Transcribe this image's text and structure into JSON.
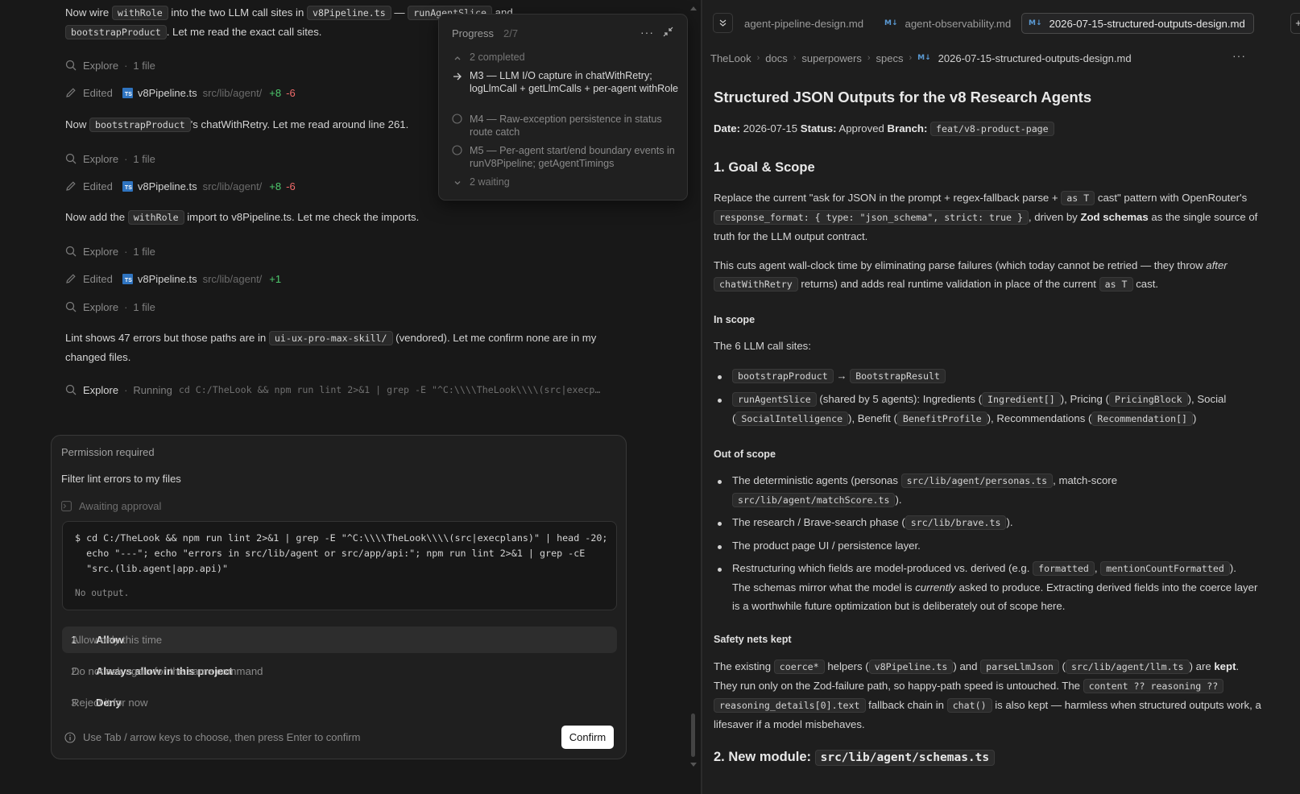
{
  "chat": {
    "msg1_a": "Now wire ",
    "msg1_code1": "withRole",
    "msg1_b": " into the two LLM call sites in ",
    "msg1_code2": "v8Pipeline.ts",
    "msg1_c": " — ",
    "msg1_code3": "runAgentSlice",
    "msg1_d": " and",
    "msg1_code4": "bootstrapProduct",
    "msg1_e": ". Let me read the exact call sites.",
    "explore_label": "Explore",
    "explore_count": "1 file",
    "edited_label": "Edited",
    "file_name": "v8Pipeline.ts",
    "file_path": "src/lib/agent/",
    "edit1_add": "+8",
    "edit1_del": "-6",
    "msg2_a": "Now ",
    "msg2_code": "bootstrapProduct",
    "msg2_b": "'s chatWithRetry. Let me read around line 261.",
    "edit2_add": "+8",
    "edit2_del": "-6",
    "msg3_a": "Now add the ",
    "msg3_code": "withRole",
    "msg3_b": " import to v8Pipeline.ts. Let me check the imports.",
    "edit3_add": "+1",
    "msg4_a": "Lint shows 47 errors but those paths are in ",
    "msg4_code": "ui-ux-pro-max-skill/",
    "msg4_b": " (vendored). Let me confirm none are in my changed files.",
    "running_label": "Running",
    "running_cmd": "cd C:/TheLook && npm run lint 2>&1 | grep -E \"^C:\\\\\\\\TheLook\\\\\\\\(src|execp…"
  },
  "progress": {
    "title": "Progress",
    "count": "2/7",
    "completed": "2 completed",
    "items": [
      {
        "text": "M3 — LLM I/O capture in chatWithRetry; logLlmCall + getLlmCalls + per-agent withRole",
        "status": "current"
      },
      {
        "text": "M4 — Raw-exception persistence in status route catch",
        "status": "pending"
      },
      {
        "text": "M5 — Per-agent start/end boundary events in runV8Pipeline; getAgentTimings",
        "status": "pending"
      }
    ],
    "waiting": "2 waiting"
  },
  "permission": {
    "title": "Permission required",
    "subtitle": "Filter lint errors to my files",
    "awaiting": "Awaiting approval",
    "command": "$ cd C:/TheLook && npm run lint 2>&1 | grep -E \"^C:\\\\\\\\TheLook\\\\\\\\(src|execplans)\" | head -20;\n  echo \"---\"; echo \"errors in src/lib/agent or src/app/api:\"; npm run lint 2>&1 | grep -cE\n  \"src.(lib.agent|app.api)\"",
    "output": "No output.",
    "options": [
      {
        "num": "1.",
        "label": "Allow",
        "desc": "Allow only this time"
      },
      {
        "num": "2.",
        "label": "Always allow in this project",
        "desc": "Do not ask again for the same command"
      },
      {
        "num": "3.",
        "label": "Deny",
        "desc": "Reject it for now"
      }
    ],
    "hint": "Use Tab / arrow keys to choose, then press Enter to confirm",
    "confirm": "Confirm"
  },
  "tabs": [
    {
      "label": "agent-pipeline-design.md",
      "active": false
    },
    {
      "label": "agent-observability.md",
      "active": false
    },
    {
      "label": "2026-07-15-structured-outputs-design.md",
      "active": true
    }
  ],
  "breadcrumb": [
    "TheLook",
    "docs",
    "superpowers",
    "specs",
    "2026-07-15-structured-outputs-design.md"
  ],
  "doc": {
    "title": "Structured JSON Outputs for the v8 Research Agents",
    "meta_date_label": "Date:",
    "meta_date": " 2026-07-15 ",
    "meta_status_label": "Status:",
    "meta_status": " Approved ",
    "meta_branch_label": "Branch:",
    "meta_branch": "feat/v8-product-page",
    "h_goal": "1. Goal & Scope",
    "p1_a": "Replace the current \"ask for JSON in the prompt + regex-fallback parse + ",
    "p1_code1": "as T",
    "p1_b": " cast\" pattern with OpenRouter's",
    "p1_code2": "response_format: { type: \"json_schema\", strict: true }",
    "p1_c": ", driven by ",
    "p1_bold": "Zod schemas",
    "p1_d": " as the single source of truth for the LLM output contract.",
    "p2_a": "This cuts agent wall-clock time by eliminating parse failures (which today cannot be retried — they throw ",
    "p2_em": "after",
    "p2_code1": "chatWithRetry",
    "p2_b": " returns) and adds real runtime validation in place of the current ",
    "p2_code2": "as T",
    "p2_c": " cast.",
    "h_inscope": "In scope",
    "inscope_intro": "The 6 LLM call sites:",
    "in1_code1": "bootstrapProduct",
    "in1_arrow": " → ",
    "in1_code2": "BootstrapResult",
    "in2_code1": "runAgentSlice",
    "in2_a": " (shared by 5 agents): Ingredients (",
    "in2_code2": "Ingredient[]",
    "in2_b": "), Pricing (",
    "in2_code3": "PricingBlock",
    "in2_c": "), Social",
    "in2_d": "(",
    "in2_code4": "SocialIntelligence",
    "in2_e": "), Benefit (",
    "in2_code5": "BenefitProfile",
    "in2_f": "), Recommendations (",
    "in2_code6": "Recommendation[]",
    "in2_g": ")",
    "h_outscope": "Out of scope",
    "out1_a": "The deterministic agents (personas ",
    "out1_code1": "src/lib/agent/personas.ts",
    "out1_b": ", match-score",
    "out1_code2": "src/lib/agent/matchScore.ts",
    "out1_c": ").",
    "out2_a": "The research / Brave-search phase (",
    "out2_code": "src/lib/brave.ts",
    "out2_b": ").",
    "out3": "The product page UI / persistence layer.",
    "out4_a": "Restructuring which fields are model-produced vs. derived (e.g. ",
    "out4_code1": "formatted",
    "out4_b": ", ",
    "out4_code2": "mentionCountFormatted",
    "out4_c": ").",
    "out4_d": "The schemas mirror what the model is ",
    "out4_em": "currently",
    "out4_e": " asked to produce. Extracting derived fields into the coerce layer is a worthwhile future optimization but is deliberately out of scope here.",
    "h_safety": "Safety nets kept",
    "s_a": "The existing ",
    "s_code1": "coerce*",
    "s_b": " helpers (",
    "s_code2": "v8Pipeline.ts",
    "s_c": ") and ",
    "s_code3": "parseLlmJson",
    "s_d": " (",
    "s_code4": "src/lib/agent/llm.ts",
    "s_e": ") are ",
    "s_bold": "kept",
    "s_f": ".",
    "s_g": "They run only on the Zod-failure path, so happy-path speed is untouched. The ",
    "s_code5": "content ?? reasoning ??",
    "s_code6": "reasoning_details[0].text",
    "s_h": " fallback chain in ",
    "s_code7": "chat()",
    "s_i": " is also kept — harmless when structured outputs work, a lifesaver if a model misbehaves.",
    "h_new": "2. New module: ",
    "h_new_code": "src/lib/agent/schemas.ts"
  },
  "colors": {
    "add": "#4ec96d",
    "del": "#f06a6a",
    "ts_badge": "#2f74c0",
    "md_icon": "#5b9bd5"
  }
}
